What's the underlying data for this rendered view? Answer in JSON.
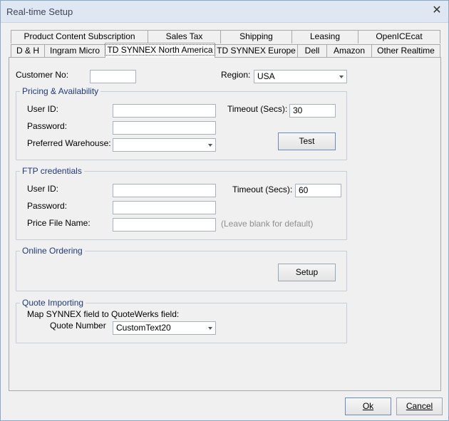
{
  "window": {
    "title": "Real-time Setup"
  },
  "tabs": {
    "row1": [
      "Product Content Subscription",
      "Sales Tax",
      "Shipping",
      "Leasing",
      "OpenICEcat"
    ],
    "row2": [
      "D & H",
      "Ingram Micro",
      "TD SYNNEX North America",
      "TD SYNNEX Europe",
      "Dell",
      "Amazon",
      "Other Realtime"
    ]
  },
  "customer": {
    "label": "Customer No:",
    "value": ""
  },
  "region": {
    "label": "Region:",
    "value": "USA"
  },
  "pricing": {
    "title": "Pricing & Availability",
    "user_id_label": "User ID:",
    "user_id": "",
    "password_label": "Password:",
    "password": "",
    "warehouse_label": "Preferred Warehouse:",
    "warehouse": "",
    "timeout_label": "Timeout (Secs):",
    "timeout": "30",
    "test_label": "Test"
  },
  "ftp": {
    "title": "FTP credentials",
    "user_id_label": "User ID:",
    "user_id": "",
    "password_label": "Password:",
    "password": "",
    "price_file_label": "Price File Name:",
    "price_file": "",
    "price_file_hint": "(Leave blank for default)",
    "timeout_label": "Timeout (Secs):",
    "timeout": "60"
  },
  "ordering": {
    "title": "Online Ordering",
    "setup_label": "Setup"
  },
  "quote": {
    "title": "Quote Importing",
    "map_label": "Map SYNNEX field to QuoteWerks field:",
    "quote_number_label": "Quote Number",
    "quote_number": "CustomText20"
  },
  "footer": {
    "ok_label": "Ok",
    "cancel_label": "Cancel"
  }
}
